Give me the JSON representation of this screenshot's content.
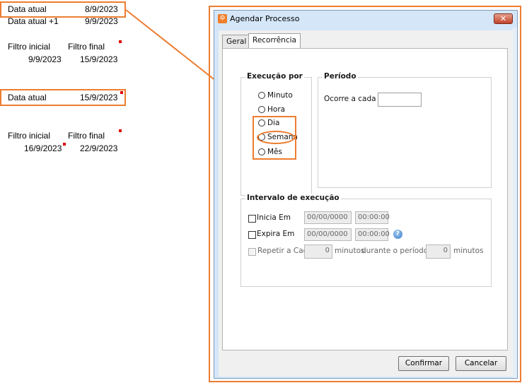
{
  "annotations": {
    "row1": {
      "label": "Data atual",
      "value": "8/9/2023"
    },
    "row2": {
      "label": "Data atual +1",
      "value": "9/9/2023"
    },
    "filter1": {
      "start_label": "Filtro inicial",
      "end_label": "Filtro final",
      "start": "9/9/2023",
      "end": "15/9/2023"
    },
    "row3": {
      "label": "Data atual",
      "value": "15/9/2023"
    },
    "filter2": {
      "start_label": "Filtro inicial",
      "end_label": "Filtro final",
      "start": "16/9/2023",
      "end": "22/9/2023"
    },
    "accent_color": "#ed7d31",
    "marker_color": "#e00000"
  },
  "dialog": {
    "title": "Agendar Processo",
    "close_glyph": "✕",
    "tabs": [
      {
        "label": "Geral",
        "active": false
      },
      {
        "label": "Recorrência",
        "active": true
      }
    ],
    "execucao": {
      "title": "Execução por",
      "options": [
        "Minuto",
        "Hora",
        "Dia",
        "Semana",
        "Mês"
      ]
    },
    "periodo": {
      "title": "Período",
      "ocorre_label": "Ocorre a cada",
      "ocorre_value": ""
    },
    "intervalo": {
      "title": "Intervalo de execução",
      "inicia_label": "Inicia Em",
      "inicia_date": "00/00/0000",
      "inicia_time": "00:00:00",
      "expira_label": "Expira Em",
      "expira_date": "00/00/0000",
      "expira_time": "00:00:00",
      "repetir_label": "Repetir a Cada",
      "repetir_value": "0",
      "minutos_label": "minutos",
      "durante_label": "durante o período de",
      "durante_value": "0",
      "minutos2_label": "minutos"
    },
    "buttons": {
      "confirm": "Confirmar",
      "cancel": "Cancelar"
    },
    "icons": {
      "title": "app-icon",
      "help": "help-icon"
    }
  }
}
